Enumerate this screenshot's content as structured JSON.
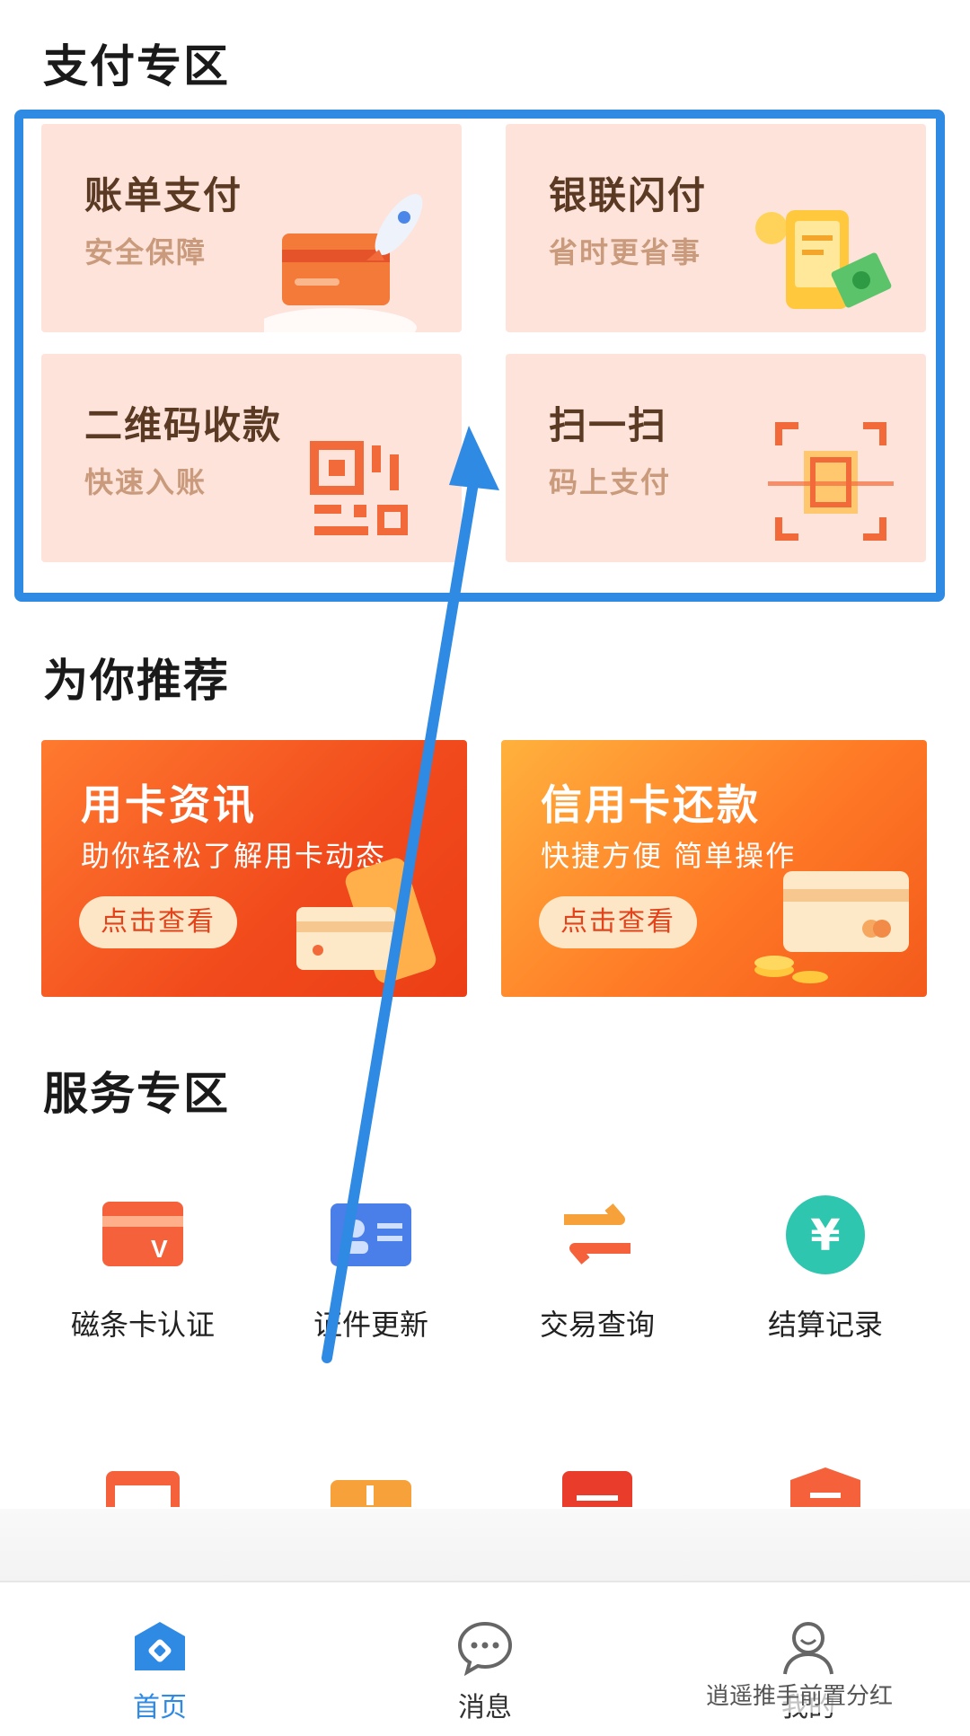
{
  "pay_section": {
    "title": "支付专区",
    "cards": [
      {
        "title": "账单支付",
        "subtitle": "安全保障",
        "icon": "card-rocket-icon"
      },
      {
        "title": "银联闪付",
        "subtitle": "省时更省事",
        "icon": "phone-money-icon"
      },
      {
        "title": "二维码收款",
        "subtitle": "快速入账",
        "icon": "qr-code-icon"
      },
      {
        "title": "扫一扫",
        "subtitle": "码上支付",
        "icon": "scan-icon"
      }
    ]
  },
  "recommend_section": {
    "title": "为你推荐",
    "banners": [
      {
        "title": "用卡资讯",
        "subtitle": "助你轻松了解用卡动态",
        "button": "点击查看"
      },
      {
        "title": "信用卡还款",
        "subtitle": "快捷方便 简单操作",
        "button": "点击查看"
      }
    ]
  },
  "service_section": {
    "title": "服务专区",
    "items": [
      {
        "label": "磁条卡认证",
        "icon": "magstripe-card-icon"
      },
      {
        "label": "证件更新",
        "icon": "id-card-icon"
      },
      {
        "label": "交易查询",
        "icon": "exchange-arrows-icon"
      },
      {
        "label": "结算记录",
        "icon": "yuan-coin-icon"
      }
    ]
  },
  "tabbar": {
    "items": [
      {
        "label": "首页",
        "icon": "home-icon",
        "active": true
      },
      {
        "label": "消息",
        "icon": "message-icon",
        "active": false
      },
      {
        "label": "我的",
        "icon": "user-icon",
        "active": false
      }
    ]
  },
  "watermark": "逍遥推手前置分红",
  "colors": {
    "highlight": "#2f8ae4",
    "card_bg": "#fde3da",
    "promo_orange": "#f14a1c",
    "active_tab": "#2f8ae4"
  }
}
